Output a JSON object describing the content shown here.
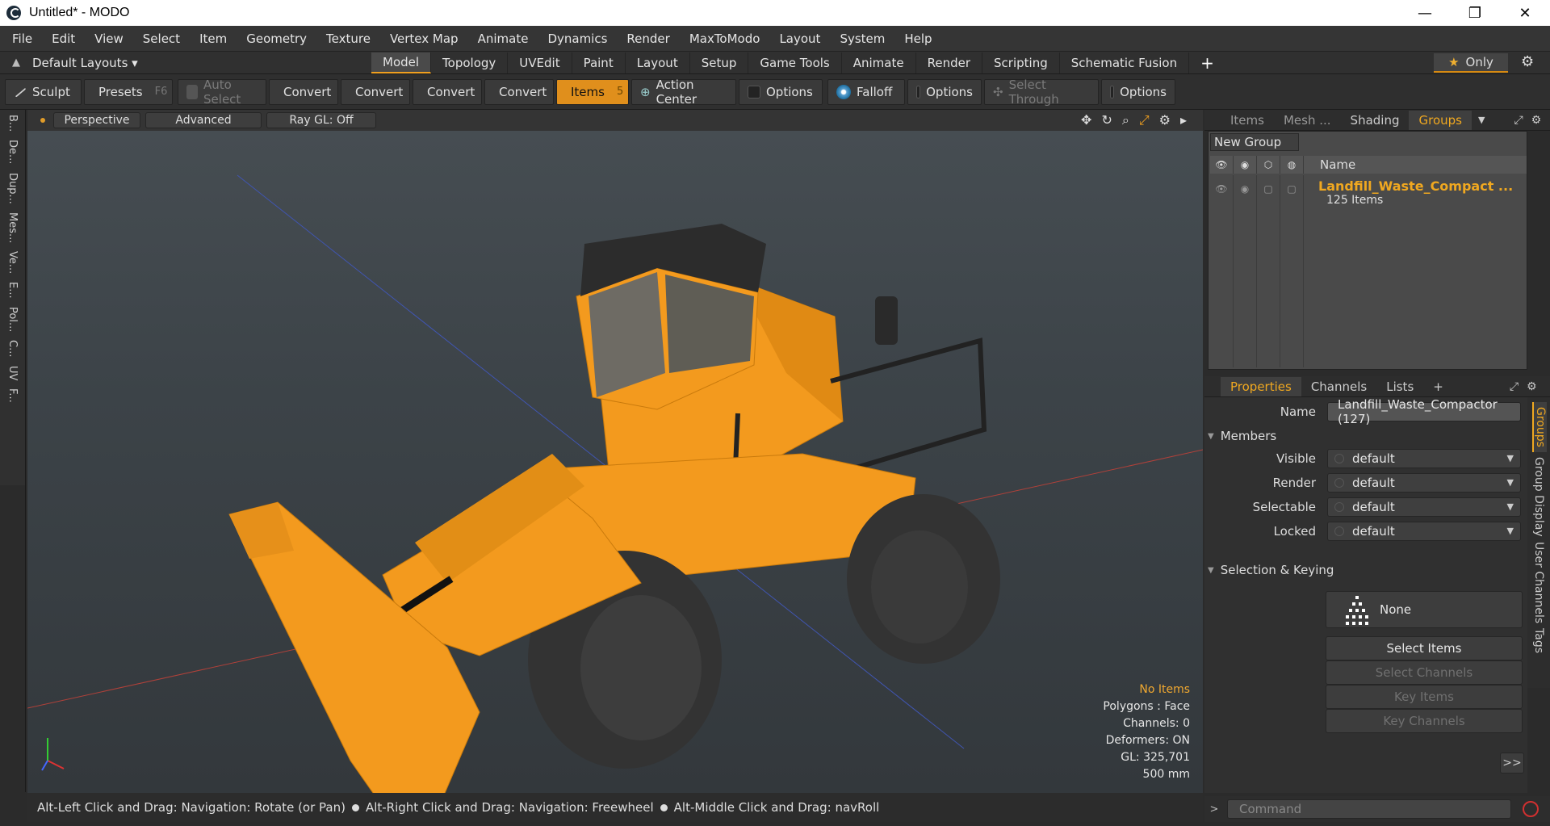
{
  "window": {
    "title": "Untitled* - MODO",
    "minimize": "—",
    "maximize": "❐",
    "close": "✕"
  },
  "menu": [
    "File",
    "Edit",
    "View",
    "Select",
    "Item",
    "Geometry",
    "Texture",
    "Vertex Map",
    "Animate",
    "Dynamics",
    "Render",
    "MaxToModo",
    "Layout",
    "System",
    "Help"
  ],
  "layoutbar": {
    "layouts_label": "Default Layouts ▾",
    "tabs": [
      "Model",
      "Topology",
      "UVEdit",
      "Paint",
      "Layout",
      "Setup",
      "Game Tools",
      "Animate",
      "Render",
      "Scripting",
      "Schematic Fusion"
    ],
    "active_tab": "Model",
    "add": "+",
    "only_label": "Only"
  },
  "toolbar": {
    "sculpt": "Sculpt",
    "presets": "Presets",
    "presets_key": "F6",
    "auto_select": "Auto Select",
    "convert": "Convert",
    "items": "Items",
    "items_key": "5",
    "action_center": "Action Center",
    "options": "Options",
    "falloff": "Falloff",
    "select_through": "Select Through"
  },
  "left_tabs": [
    "B...",
    "De...",
    "Dup...",
    "Mes...",
    "Ve...",
    "E...",
    "Pol...",
    "C...",
    "UV",
    "F..."
  ],
  "viewport": {
    "perspective": "Perspective",
    "advanced": "Advanced",
    "raygl": "Ray GL: Off",
    "hud": {
      "no_items": "No Items",
      "polygons": "Polygons : Face",
      "channels": "Channels: 0",
      "deformers": "Deformers: ON",
      "gl": "GL: 325,701",
      "scale": "500 mm"
    },
    "body_color": "#f39a1e",
    "dark_color": "#262626"
  },
  "status": {
    "hint1": "Alt-Left Click and Drag: Navigation: Rotate (or Pan)",
    "hint2": "Alt-Right Click and Drag: Navigation: Freewheel",
    "hint3": "Alt-Middle Click and Drag: navRoll"
  },
  "groups_panel": {
    "tabs": [
      "Items",
      "Mesh ...",
      "Shading",
      "Groups"
    ],
    "active_tab": "Groups",
    "new_group": "New Group",
    "name_header": "Name",
    "group_name": "Landfill_Waste_Compact ...",
    "group_count": "125 Items"
  },
  "properties": {
    "tabs": [
      "Properties",
      "Channels",
      "Lists",
      "+"
    ],
    "active_tab": "Properties",
    "name_label": "Name",
    "name_value": "Landfill_Waste_Compactor (127)",
    "members": "Members",
    "visible_label": "Visible",
    "visible": "default",
    "render_label": "Render",
    "render": "default",
    "selectable_label": "Selectable",
    "selectable": "default",
    "locked_label": "Locked",
    "locked": "default",
    "selection_keying": "Selection & Keying",
    "none": "None",
    "select_items": "Select Items",
    "select_channels": "Select Channels",
    "key_items": "Key Items",
    "key_channels": "Key Channels",
    "expand": ">>"
  },
  "right_vtabs": [
    "Groups",
    "Group Display",
    "User Channels",
    "Tags"
  ],
  "command": {
    "placeholder": "Command"
  }
}
